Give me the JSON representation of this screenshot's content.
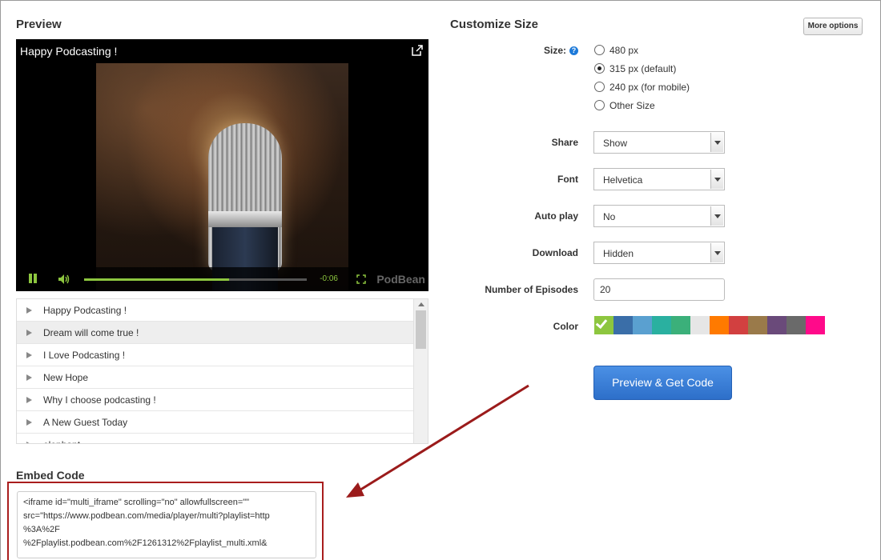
{
  "preview": {
    "heading": "Preview",
    "player": {
      "title": "Happy Podcasting !",
      "time_remaining": "-0:06",
      "brand": "PodBean",
      "progress_fraction": 0.65,
      "accent_color": "#8dc63f"
    },
    "episodes": [
      {
        "label": "Happy Podcasting !"
      },
      {
        "label": "Dream will come true !"
      },
      {
        "label": "I Love Podcasting !"
      },
      {
        "label": "New Hope"
      },
      {
        "label": "Why I choose podcasting !"
      },
      {
        "label": "A New Guest Today"
      },
      {
        "label": "elephant"
      }
    ],
    "active_episode_index": 1
  },
  "embed": {
    "heading": "Embed Code",
    "lines": [
      "<iframe id=\"multi_iframe\" scrolling=\"no\" allowfullscreen=\"\"",
      "src=\"https://www.podbean.com/media/player/multi?playlist=http",
      "%3A%2F",
      "%2Fplaylist.podbean.com%2F1261312%2Fplaylist_multi.xml&"
    ]
  },
  "customize": {
    "heading": "Customize Size",
    "more_options_label": "More options",
    "size": {
      "label": "Size:",
      "help_icon": "?",
      "options": [
        "480 px",
        "315 px (default)",
        "240 px (for mobile)",
        "Other Size"
      ],
      "selected_index": 1
    },
    "share": {
      "label": "Share",
      "value": "Show"
    },
    "font": {
      "label": "Font",
      "value": "Helvetica"
    },
    "autoplay": {
      "label": "Auto play",
      "value": "No"
    },
    "download": {
      "label": "Download",
      "value": "Hidden"
    },
    "episodes_count": {
      "label": "Number of Episodes",
      "value": "20"
    },
    "color": {
      "label": "Color",
      "swatches": [
        "#8dc63f",
        "#3a6ea8",
        "#5aa0d0",
        "#2ab0a0",
        "#3bb07a",
        "#e6e6e6",
        "#ff7a00",
        "#d24040",
        "#9a7a4a",
        "#6a4a7a",
        "#6a6a6a",
        "#ff0a8a"
      ],
      "selected_index": 0
    },
    "submit_label": "Preview & Get Code"
  }
}
